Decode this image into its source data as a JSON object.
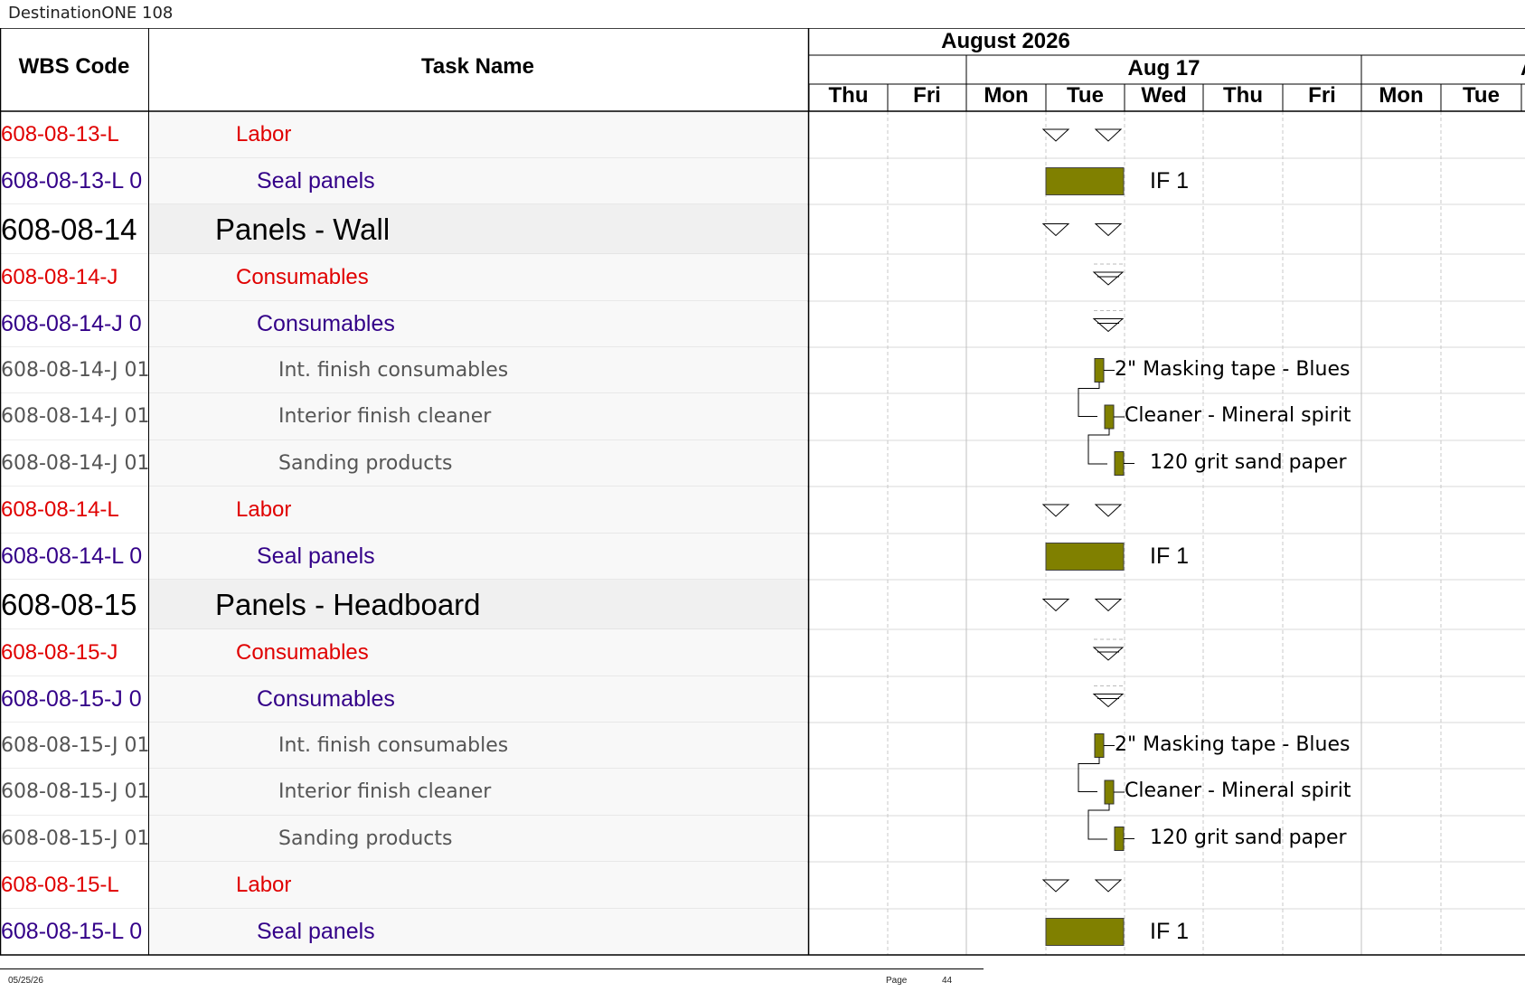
{
  "document": {
    "title": "DestinationONE 108"
  },
  "header": {
    "wbs_label": "WBS Code",
    "task_label": "Task Name",
    "month": "August 2026",
    "week": "Aug 17",
    "days": [
      "Thu",
      "Fri",
      "Mon",
      "Tue",
      "Wed",
      "Thu",
      "Fri",
      "Mon",
      "Tue"
    ],
    "overflow_glyph": "A"
  },
  "colors": {
    "level_red": "#e00000",
    "level_purple": "#330088",
    "level_gray": "#555555",
    "bar": "#808000",
    "grid": "#c8c8c8"
  },
  "rows": [
    {
      "wbs": "608-08-13-L",
      "name": "Labor",
      "level": "red",
      "gantt": "summary"
    },
    {
      "wbs": "608-08-13-L 0",
      "name": "Seal panels",
      "level": "purple",
      "gantt": "bar",
      "label": "IF 1"
    },
    {
      "wbs": "608-08-14",
      "name": "Panels - Wall",
      "level": "group",
      "gantt": "summary"
    },
    {
      "wbs": "608-08-14-J",
      "name": "Consumables",
      "level": "red",
      "gantt": "milestone"
    },
    {
      "wbs": "608-08-14-J 0",
      "name": "Consumables",
      "level": "purple",
      "gantt": "milestone"
    },
    {
      "wbs": "608-08-14-J 01",
      "name": "Int. finish consumables",
      "level": "gray",
      "gantt": "small",
      "offset": 0,
      "label": "2\" Masking tape - Blues"
    },
    {
      "wbs": "608-08-14-J 01",
      "name": "Interior finish cleaner",
      "level": "gray",
      "gantt": "small",
      "offset": 1,
      "label": "Cleaner - Mineral spirit"
    },
    {
      "wbs": "608-08-14-J 01",
      "name": "Sanding products",
      "level": "gray",
      "gantt": "small",
      "offset": 2,
      "label": "120 grit sand paper"
    },
    {
      "wbs": "608-08-14-L",
      "name": "Labor",
      "level": "red",
      "gantt": "summary"
    },
    {
      "wbs": "608-08-14-L 0",
      "name": "Seal panels",
      "level": "purple",
      "gantt": "bar",
      "label": "IF 1"
    },
    {
      "wbs": "608-08-15",
      "name": "Panels - Headboard",
      "level": "group",
      "gantt": "summary"
    },
    {
      "wbs": "608-08-15-J",
      "name": "Consumables",
      "level": "red",
      "gantt": "milestone"
    },
    {
      "wbs": "608-08-15-J 0",
      "name": "Consumables",
      "level": "purple",
      "gantt": "milestone"
    },
    {
      "wbs": "608-08-15-J 01",
      "name": "Int. finish consumables",
      "level": "gray",
      "gantt": "small",
      "offset": 0,
      "label": "2\" Masking tape - Blues"
    },
    {
      "wbs": "608-08-15-J 01",
      "name": "Interior finish cleaner",
      "level": "gray",
      "gantt": "small",
      "offset": 1,
      "label": "Cleaner - Mineral spirit"
    },
    {
      "wbs": "608-08-15-J 01",
      "name": "Sanding products",
      "level": "gray",
      "gantt": "small",
      "offset": 2,
      "label": "120 grit sand paper"
    },
    {
      "wbs": "608-08-15-L",
      "name": "Labor",
      "level": "red",
      "gantt": "summary"
    },
    {
      "wbs": "608-08-15-L 0",
      "name": "Seal panels",
      "level": "purple",
      "gantt": "bar",
      "label": "IF 1"
    }
  ],
  "footer": {
    "date": "05/25/26",
    "page_label": "Page",
    "page_number": "44"
  }
}
